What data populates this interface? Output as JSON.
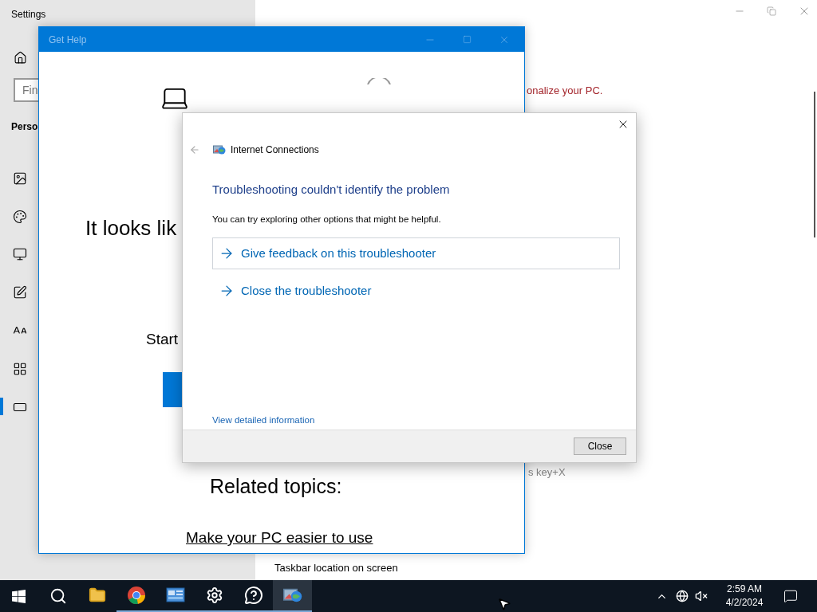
{
  "settings_window": {
    "title": "Settings",
    "search": {
      "value": "Fin"
    },
    "section_heading": "Perso",
    "nav_items": [
      {
        "kind": "background",
        "selected": false
      },
      {
        "kind": "colors",
        "selected": false
      },
      {
        "kind": "lock-screen",
        "selected": false
      },
      {
        "kind": "themes",
        "selected": false
      },
      {
        "kind": "fonts",
        "selected": false
      },
      {
        "kind": "start",
        "selected": false
      },
      {
        "kind": "taskbar",
        "selected": true
      }
    ],
    "notice": "onalize your PC.",
    "shortcut_hint": "s key+X",
    "setting_label": "Taskbar location on screen"
  },
  "get_help_window": {
    "title": "Get Help",
    "headline": "It looks lik",
    "prompt": "Start",
    "related_heading": "Related topics:",
    "related_links": [
      "Make your PC easier to use"
    ]
  },
  "troubleshooter_dialog": {
    "title": "Internet Connections",
    "heading": "Troubleshooting couldn't identify the problem",
    "message": "You can try exploring other options that might be helpful.",
    "options": [
      {
        "label": "Give feedback on this troubleshooter",
        "selected": true
      },
      {
        "label": "Close the troubleshooter",
        "selected": false
      }
    ],
    "details_link": "View detailed information",
    "buttons": [
      "Close"
    ]
  },
  "taskbar": {
    "apps": [
      {
        "kind": "file-explorer",
        "open": false,
        "selected": false
      },
      {
        "kind": "browser",
        "open": true,
        "selected": false
      },
      {
        "kind": "control-panel",
        "open": true,
        "selected": false
      },
      {
        "kind": "settings",
        "open": true,
        "selected": false
      },
      {
        "kind": "get-help",
        "open": true,
        "selected": false
      },
      {
        "kind": "troubleshooter",
        "open": true,
        "selected": true
      }
    ],
    "clock": {
      "time": "2:59 AM",
      "date": "4/2/2024"
    }
  }
}
